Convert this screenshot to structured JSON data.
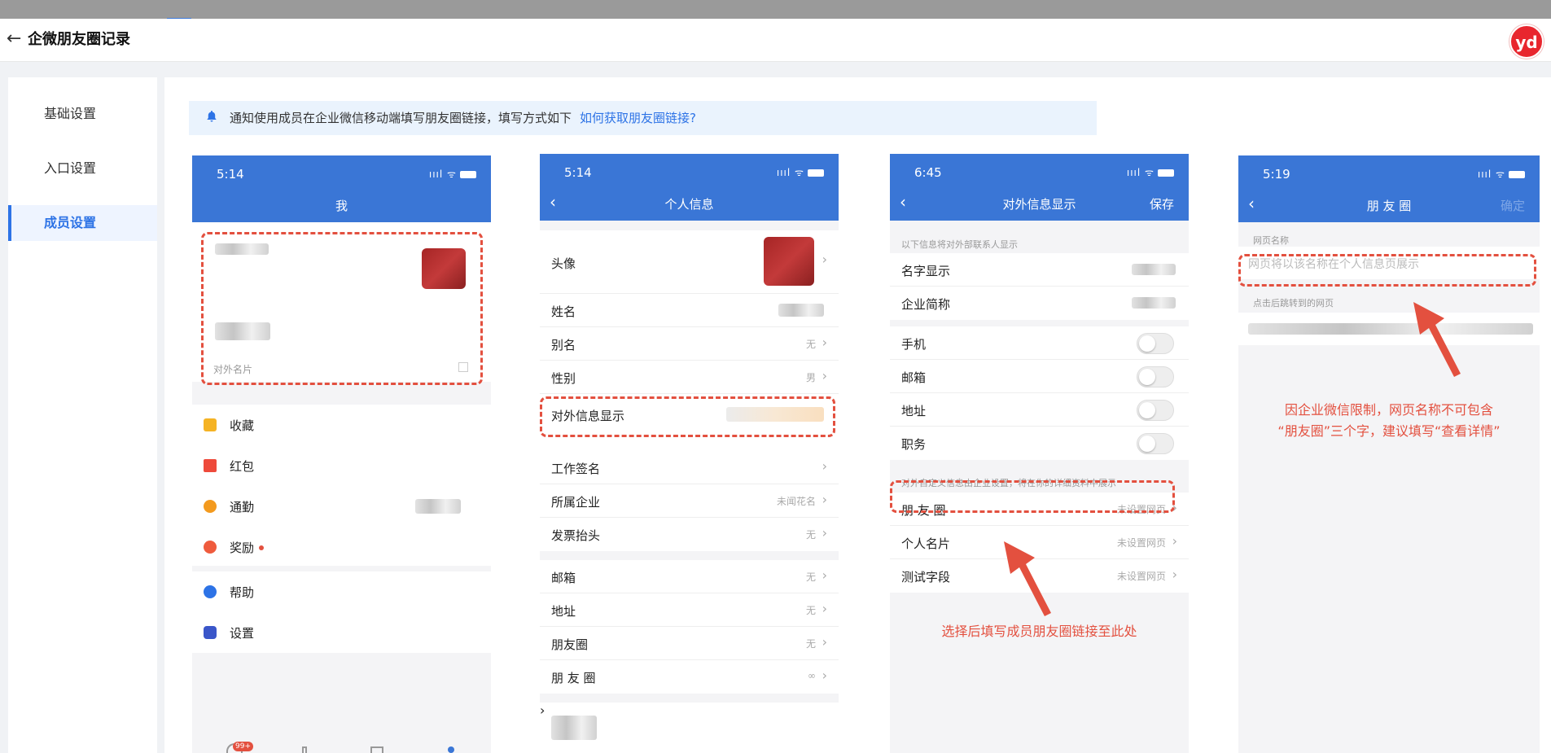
{
  "header": {
    "title": "企微朋友圈记录",
    "logo_text": "yd"
  },
  "sidebar": {
    "items": [
      {
        "label": "基础设置"
      },
      {
        "label": "入口设置"
      },
      {
        "label": "成员设置"
      }
    ]
  },
  "notice": {
    "text": "通知使用成员在企业微信移动端填写朋友圈链接，填写方式如下",
    "link": "如何获取朋友圈链接?"
  },
  "phone1": {
    "time": "5:14",
    "title": "我",
    "card_caption": "对外名片",
    "menu": [
      {
        "label": "收藏",
        "icon": "package-icon",
        "color": "#f5b324"
      },
      {
        "label": "红包",
        "icon": "red-envelope-icon",
        "color": "#ee4a3b"
      },
      {
        "label": "通勤",
        "icon": "clock-icon",
        "color": "#f39a1e"
      },
      {
        "label": "奖励",
        "icon": "medal-icon",
        "color": "#ef5b3d"
      }
    ],
    "menu2": [
      {
        "label": "帮助",
        "icon": "help-icon",
        "color": "#2d73e6"
      },
      {
        "label": "设置",
        "icon": "settings-icon",
        "color": "#3a56c9"
      }
    ],
    "badge": "99+"
  },
  "phone2": {
    "time": "5:14",
    "title": "个人信息",
    "rows_a": [
      {
        "label": "头像",
        "value": ""
      },
      {
        "label": "姓名",
        "value": ""
      },
      {
        "label": "别名",
        "value": "无"
      },
      {
        "label": "性别",
        "value": "男"
      },
      {
        "label": "对外信息显示",
        "value": ""
      }
    ],
    "rows_b": [
      {
        "label": "工作签名",
        "value": ""
      },
      {
        "label": "所属企业",
        "value": "未闻花名"
      },
      {
        "label": "发票抬头",
        "value": "无"
      }
    ],
    "rows_c": [
      {
        "label": "邮箱",
        "value": "无"
      },
      {
        "label": "地址",
        "value": "无"
      },
      {
        "label": "朋友圈",
        "value": "无"
      },
      {
        "label": "朋 友 圈",
        "value": "∞"
      }
    ]
  },
  "phone3": {
    "time": "6:45",
    "title": "对外信息显示",
    "save": "保存",
    "caption_top": "以下信息将对外部联系人显示",
    "rows_a": [
      {
        "label": "名字显示"
      },
      {
        "label": "企业简称"
      }
    ],
    "toggles": [
      {
        "label": "手机"
      },
      {
        "label": "邮箱"
      },
      {
        "label": "地址"
      },
      {
        "label": "职务"
      }
    ],
    "caption_mid": "对外自定义信息由企业设置，将在你的详细资料中展示",
    "rows_b": [
      {
        "label": "朋 友 圈",
        "value": "未设置网页"
      },
      {
        "label": "个人名片",
        "value": "未设置网页"
      },
      {
        "label": "测试字段",
        "value": "未设置网页"
      }
    ],
    "note": "选择后填写成员朋友圈链接至此处"
  },
  "phone4": {
    "time": "5:19",
    "title": "朋 友 圈",
    "confirm": "确定",
    "name_label": "网页名称",
    "name_placeholder": "网页将以该名称在个人信息页展示",
    "url_label": "点击后跳转到的网页",
    "note_line1": "因企业微信限制，网页名称不可包含",
    "note_line2": "“朋友圈”三个字，建议填写“查看详情”"
  }
}
